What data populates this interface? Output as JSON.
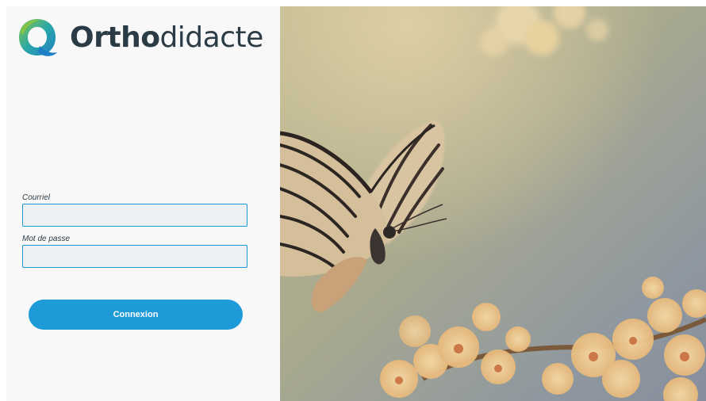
{
  "brand": {
    "name_bold": "Ortho",
    "name_regular": "didacte",
    "colors": {
      "teal": "#2aa8a8",
      "blue": "#1e7fc4",
      "green": "#8cc63f",
      "text": "#2a3b46"
    }
  },
  "login_form": {
    "email_label": "Courriel",
    "email_value": "",
    "password_label": "Mot de passe",
    "password_value": "",
    "submit_label": "Connexion",
    "accent_color": "#1e9ad9"
  },
  "background_image": {
    "icon": "butterfly-on-blossoms-photo"
  }
}
